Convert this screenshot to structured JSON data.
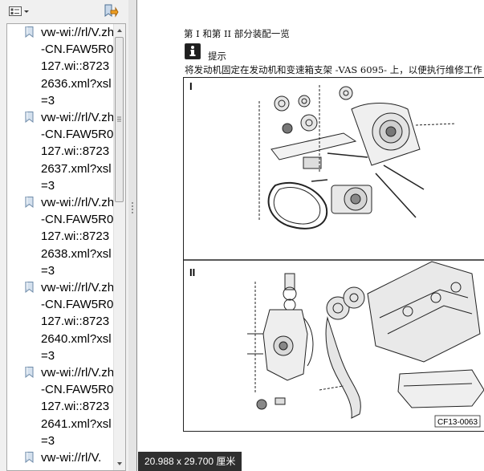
{
  "bookmarks": [
    {
      "label": "vw-wi://rl/V.zh-CN.FAW5R0127.wi::87232636.xml?xsl=3"
    },
    {
      "label": "vw-wi://rl/V.zh-CN.FAW5R0127.wi::87232637.xml?xsl=3"
    },
    {
      "label": "vw-wi://rl/V.zh-CN.FAW5R0127.wi::87232638.xml?xsl=3"
    },
    {
      "label": "vw-wi://rl/V.zh-CN.FAW5R0127.wi::87232640.xml?xsl=3"
    },
    {
      "label": "vw-wi://rl/V.zh-CN.FAW5R0127.wi::87232641.xml?xsl=3"
    },
    {
      "label": "vw-wi://rl/V."
    }
  ],
  "document": {
    "title": "第 I 和第 II 部分装配一览",
    "note_label": "提示",
    "note_text": "将发动机固定在发动机和变速箱支架 -VAS 6095- 上，以便执行维修工作",
    "panel_labels": [
      "I",
      "II"
    ],
    "figure_code": "CF13-0063"
  },
  "status": {
    "page_size": "20.988 x 29.700 厘米"
  },
  "icons": {
    "options": "options-icon",
    "bookmark_tool": "bookmark-tool-icon",
    "bookmark": "bookmark-icon",
    "note": "info-icon"
  }
}
